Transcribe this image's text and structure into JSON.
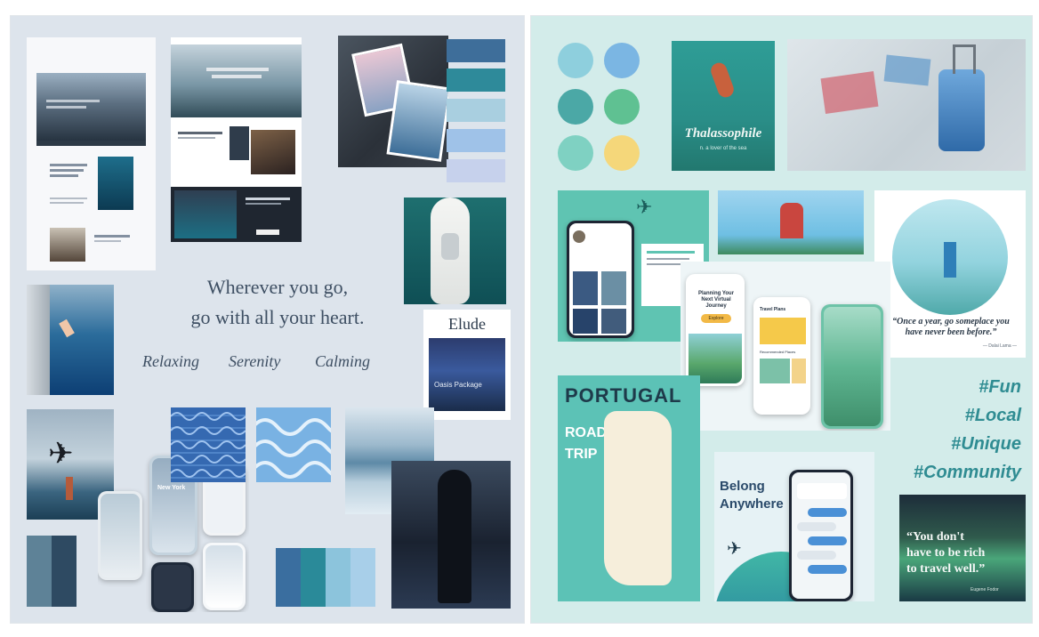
{
  "left_board": {
    "quote_line1": "Wherever you go,",
    "quote_line2": "go with all your heart.",
    "moods": [
      "Relaxing",
      "Serenity",
      "Calming"
    ],
    "elude_title": "Elude",
    "elude_caption": "Oasis Package",
    "mobile_city": "New York",
    "swatches_top": [
      "#3e6e9a",
      "#2e8a9a",
      "#a9cfe0",
      "#9fc2e8",
      "#c6d1ec"
    ],
    "swatches_bottom_left": [
      "#5e8297",
      "#2e4a62"
    ],
    "swatches_bottom_right": [
      "#3a6e9f",
      "#2a8a99",
      "#8cc4dc",
      "#a8cfe9"
    ]
  },
  "right_board": {
    "color_dots": [
      "#8ecfdd",
      "#7bb6e3",
      "#4ba8a6",
      "#5fc192",
      "#7fd1c2",
      "#f5d77a"
    ],
    "poster_title": "Thalassophile",
    "poster_caption": "n. a lover of the sea",
    "app_headline": "Planning Your Next Virtual Journey",
    "app_button": "Explore",
    "app_title": "Travel Plans",
    "app_section": "Recommended Places",
    "quote_text": "“Once a year, go someplace you have never been before.”",
    "quote_author": "— Dalai Lama —",
    "hashtags": [
      "#Fun",
      "#Local",
      "#Unique",
      "#Community"
    ],
    "portugal_title": "PORTUGAL",
    "portugal_ribbon": "ROAD",
    "portugal_trip": "TRIP",
    "belong_line1": "Belong",
    "belong_line2": "Anywhere",
    "aurora_quote_line1": "“You don't",
    "aurora_quote_line2": "have to be rich",
    "aurora_quote_line3": "to travel well.”",
    "aurora_author": "Eugene Fodor"
  }
}
